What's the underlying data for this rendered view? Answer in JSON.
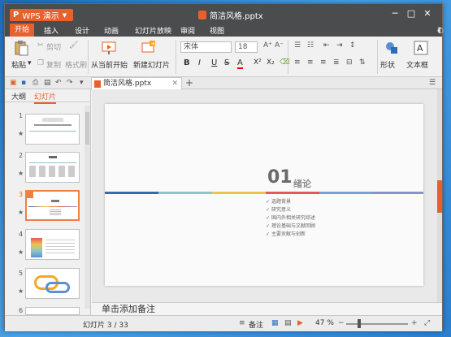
{
  "app": {
    "label": "WPS 演示",
    "logo": "P"
  },
  "document": {
    "title": "简洁风格.pptx"
  },
  "menu": [
    "开始",
    "插入",
    "设计",
    "动画",
    "幻灯片放映",
    "审阅",
    "视图"
  ],
  "ribbon": {
    "paste": "粘贴",
    "cut": "剪切",
    "copy": "复制",
    "format_painter": "格式刷",
    "from_current": "从当前开始",
    "new_slide": "新建幻灯片",
    "font_name": "宋体",
    "font_size": "18",
    "bold": "B",
    "italic": "I",
    "underline": "U",
    "strike": "S",
    "font_color": "A",
    "superscript": "X²",
    "subscript": "X₂",
    "shape": "形状",
    "textbox": "文本框"
  },
  "tab": {
    "label": "简洁风格.pptx"
  },
  "sidebar": {
    "tab_outline": "大纲",
    "tab_slides": "幻灯片",
    "slide_numbers": [
      "1",
      "2",
      "3",
      "4",
      "5",
      "6"
    ]
  },
  "slide": {
    "number": "01",
    "title": "绪论",
    "bullets": [
      "选题背景",
      "研究意义",
      "国内外相关研究综述",
      "理论基础与文献回顾",
      "主要贡献与创新"
    ]
  },
  "notes": {
    "placeholder": "单击添加备注"
  },
  "status": {
    "slide_counter": "幻灯片 3 / 33",
    "notes": "备注",
    "zoom": "47 %"
  },
  "colors": {
    "accent": "#e8612c",
    "bar": [
      "#2f6db0",
      "#8cc5c5",
      "#f0c24a",
      "#e4585a",
      "#7aa0d8",
      "#8a8fd0"
    ]
  }
}
